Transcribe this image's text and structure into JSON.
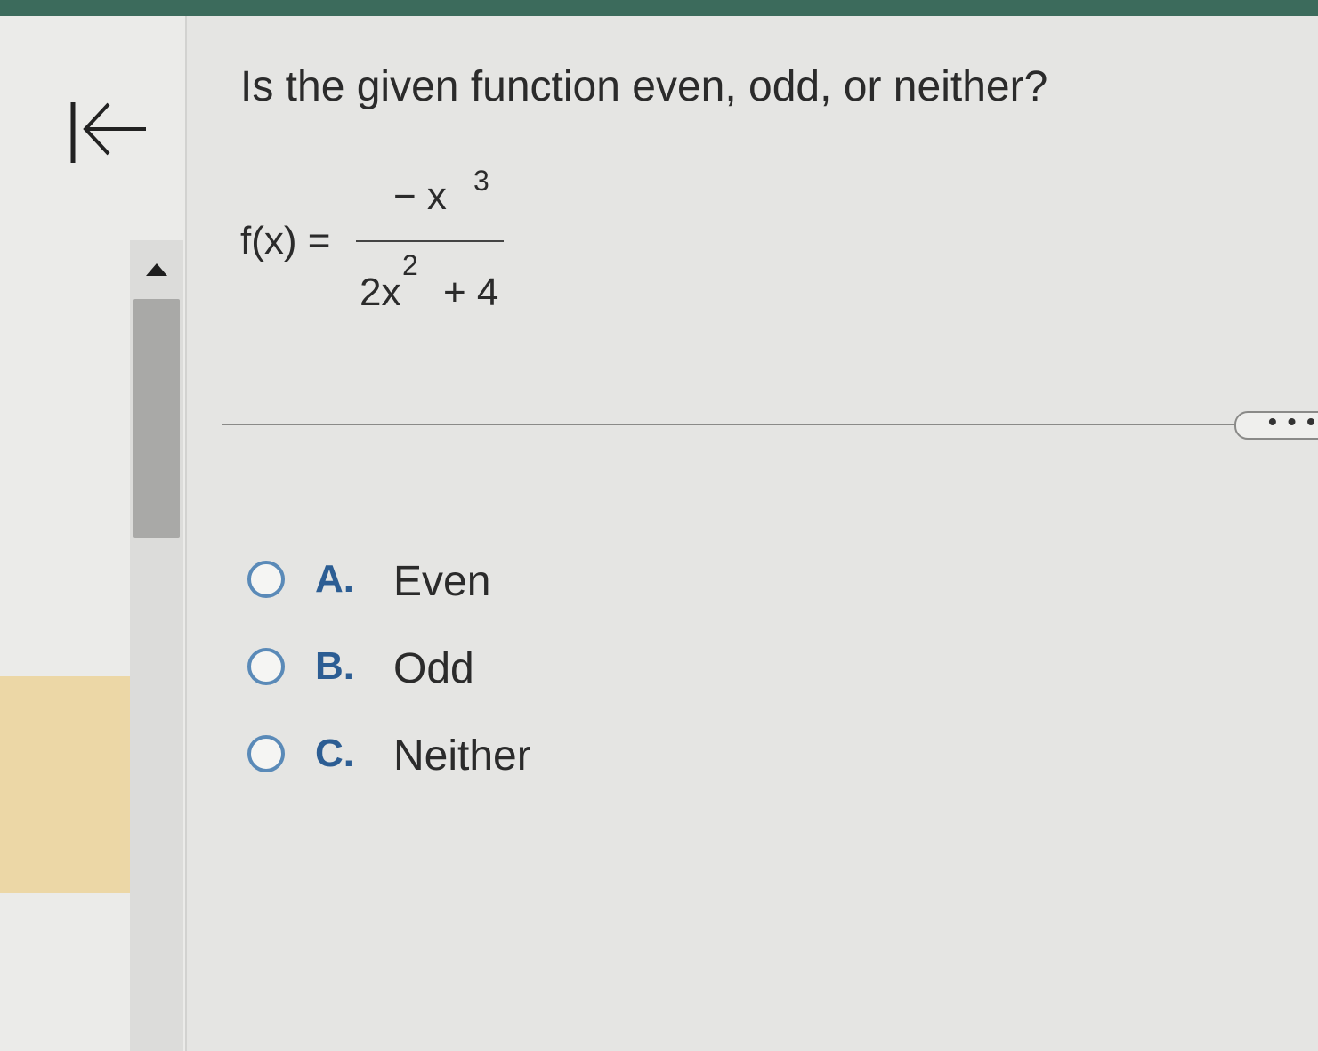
{
  "question": {
    "text": "Is the given function even, odd, or neither?"
  },
  "formula": {
    "lhs": "f(x) =",
    "numerator_base": "− x",
    "numerator_exponent": "3",
    "denominator_term": "2x",
    "denominator_exponent": "2",
    "denominator_rest": "+ 4"
  },
  "more_button": {
    "label": "• • •"
  },
  "options": [
    {
      "letter": "A.",
      "text": "Even"
    },
    {
      "letter": "B.",
      "text": "Odd"
    },
    {
      "letter": "C.",
      "text": "Neither"
    }
  ],
  "colors": {
    "top_bar": "#3c6b5c",
    "option_letter": "#2c5d93",
    "radio_border": "#5a8ab8",
    "left_highlight": "#ecd7a6"
  },
  "icons": {
    "collapse": "collapse-left-icon",
    "scroll_up": "triangle-up-icon",
    "more": "ellipsis-icon"
  }
}
